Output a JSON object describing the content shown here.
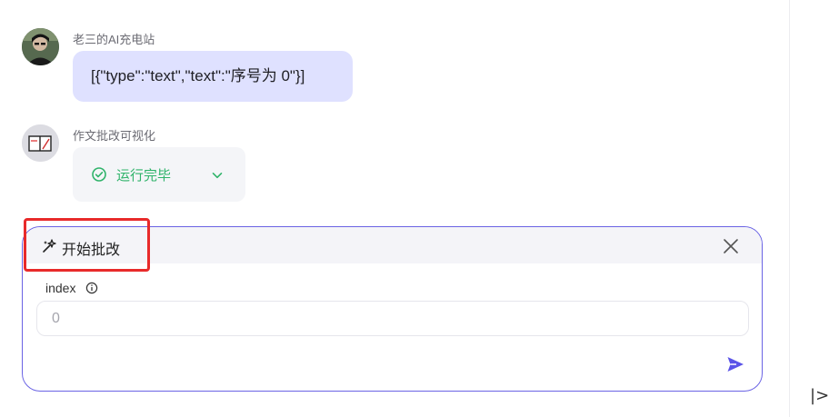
{
  "user_message": {
    "sender": "老三的AI充电站",
    "text": "[{\"type\":\"text\",\"text\":\"序号为 0\"}]",
    "avatar_icon": "user-portrait-avatar"
  },
  "bot_message": {
    "sender": "作文批改可视化",
    "status": "运行完毕",
    "status_icon": "check-circle-icon",
    "status_color": "#2fb36a",
    "avatar_icon": "notebook-avatar"
  },
  "composer": {
    "plugin_title": "开始批改",
    "plugin_icon": "sparkle-magic-icon",
    "param_label": "index",
    "param_placeholder": "0",
    "accent_color": "#5b54e8"
  },
  "sidebar": {
    "collapse_glyph": "|>"
  }
}
